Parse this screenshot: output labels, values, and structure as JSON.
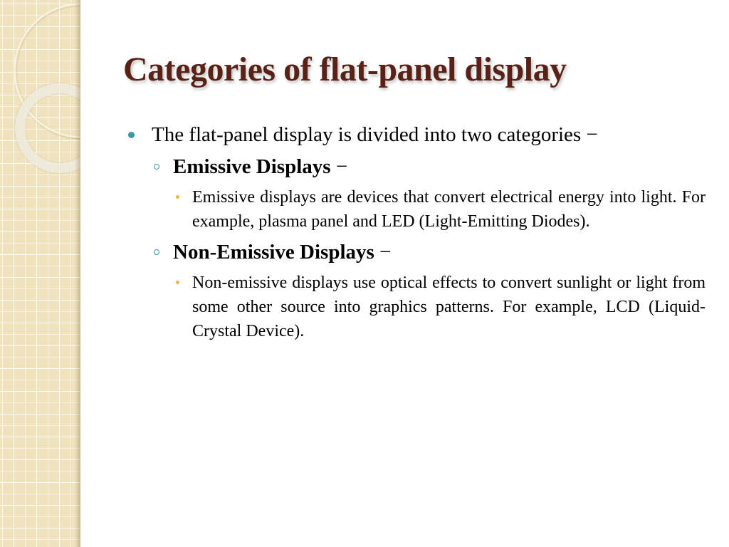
{
  "slide": {
    "title": "Categories of flat-panel display",
    "colors": {
      "title": "#5a2217",
      "bullet_primary": "#3c94a8",
      "bullet_secondary": "#f2b632",
      "sidebar": "#efe2bd"
    },
    "intro": {
      "icon": "filled-circle-bullet",
      "text": "The flat-panel display is divided into two categories −"
    },
    "categories": [
      {
        "icon": "hollow-circle-bullet",
        "heading": "Emissive Displays",
        "dash": "−",
        "details": [
          {
            "icon": "small-dot-bullet",
            "text": "Emissive displays are devices that convert electrical energy into light. For example, plasma panel and LED (Light-Emitting Diodes)."
          }
        ]
      },
      {
        "icon": "hollow-circle-bullet",
        "heading": "Non-Emissive Displays",
        "dash": "−",
        "details": [
          {
            "icon": "small-dot-bullet",
            "text": "Non-emissive displays use optical effects to convert sunlight or light from some other source into graphics patterns. For example, LCD (Liquid-Crystal Device)."
          }
        ]
      }
    ]
  }
}
